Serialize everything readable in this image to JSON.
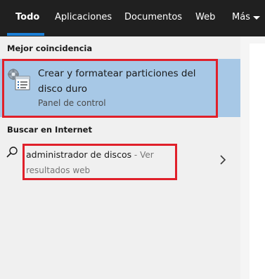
{
  "tabs": [
    {
      "label": "Todo",
      "active": true
    },
    {
      "label": "Aplicaciones",
      "active": false
    },
    {
      "label": "Documentos",
      "active": false
    },
    {
      "label": "Web",
      "active": false
    },
    {
      "label": "Más",
      "active": false
    }
  ],
  "best_match": {
    "heading": "Mejor coincidencia",
    "title": "Crear y formatear particiones del disco duro",
    "subtitle": "Panel de control",
    "icon": "control-panel-disk-icon"
  },
  "web_search": {
    "heading": "Buscar en Internet",
    "query": "administrador de discos",
    "suffix": " - Ver resultados web",
    "icon": "search-icon"
  },
  "colors": {
    "topbar": "#202020",
    "accent": "#1a7fd6",
    "selected_bg": "#a7c8e6",
    "annotation_red": "#e0202a"
  }
}
